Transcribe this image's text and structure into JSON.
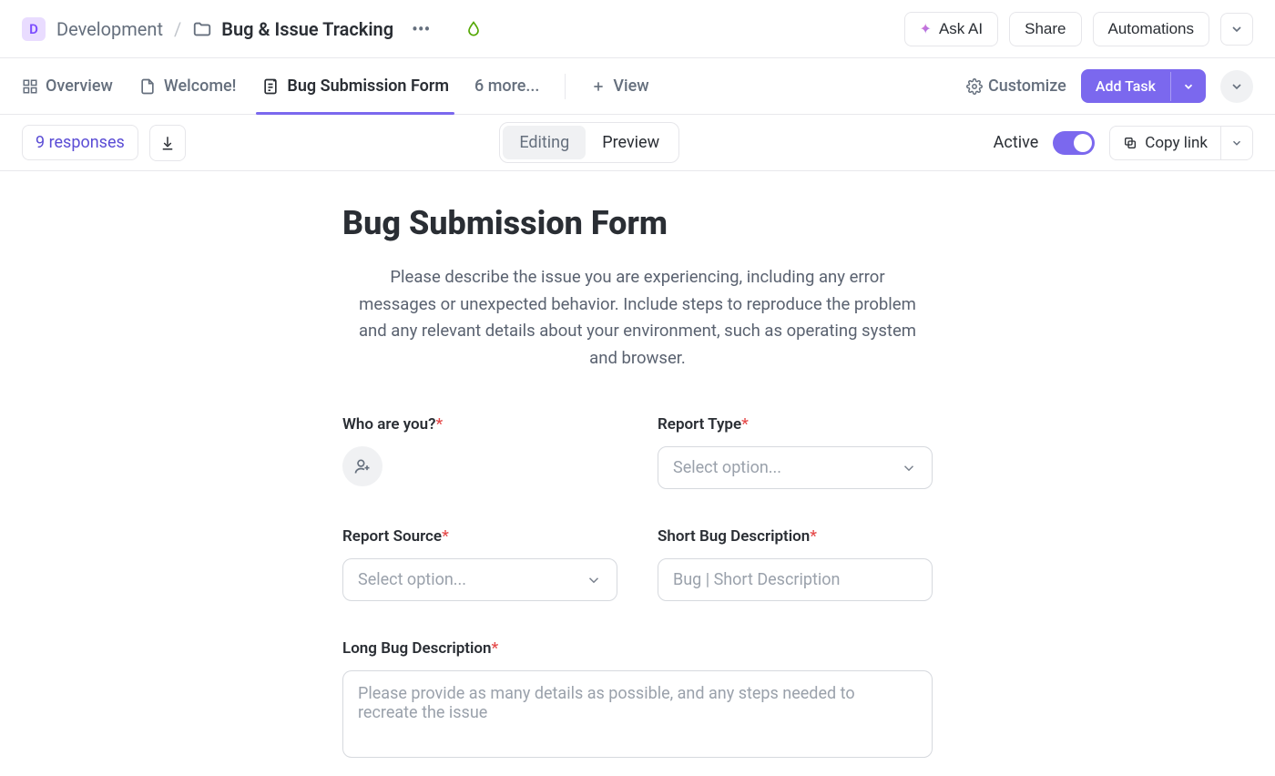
{
  "breadcrumb": {
    "badge_letter": "D",
    "parent": "Development",
    "title": "Bug & Issue Tracking"
  },
  "header_actions": {
    "ask_ai": "Ask AI",
    "share": "Share",
    "automations": "Automations"
  },
  "tabs": {
    "overview": "Overview",
    "welcome": "Welcome!",
    "bug_form": "Bug Submission Form",
    "more": "6 more...",
    "add_view": "View"
  },
  "tabs_right": {
    "customize": "Customize",
    "add_task": "Add Task"
  },
  "toolbar": {
    "responses": "9 responses",
    "editing": "Editing",
    "preview": "Preview",
    "active": "Active",
    "copy_link": "Copy link"
  },
  "form": {
    "title": "Bug Submission Form",
    "description": "Please describe the issue you are experiencing, including any error messages or unexpected behavior. Include steps to reproduce the problem and any relevant details about your environment, such as operating system and browser.",
    "fields": {
      "who": {
        "label": "Who are you?"
      },
      "report_type": {
        "label": "Report Type",
        "placeholder": "Select option..."
      },
      "report_source": {
        "label": "Report Source",
        "placeholder": "Select option..."
      },
      "short_desc": {
        "label": "Short Bug Description",
        "placeholder": "Bug | Short Description"
      },
      "long_desc": {
        "label": "Long Bug Description",
        "placeholder": "Please provide as many details as possible, and any steps needed to recreate the issue"
      }
    }
  }
}
